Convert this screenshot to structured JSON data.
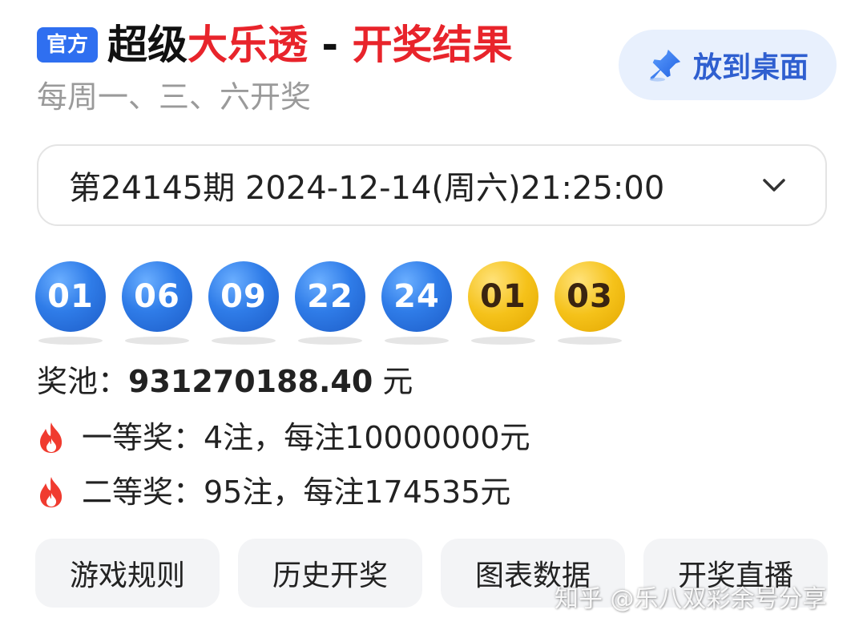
{
  "header": {
    "badge": "官方",
    "title_part1": "超级",
    "title_part2": "大乐透",
    "title_sep": " - ",
    "title_part3": "开奖结果",
    "subtitle": "每周一、三、六开奖",
    "pin_label": "放到桌面"
  },
  "issue": {
    "label": "第24145期 2024-12-14(周六)21:25:00"
  },
  "balls": {
    "front": [
      "01",
      "06",
      "09",
      "22",
      "24"
    ],
    "back": [
      "01",
      "03"
    ]
  },
  "pool": {
    "label": "奖池：",
    "value": "931270188.40",
    "unit": " 元"
  },
  "prizes": [
    {
      "text": "一等奖：4注，每注10000000元"
    },
    {
      "text": "二等奖：95注，每注174535元"
    }
  ],
  "actions": [
    "游戏规则",
    "历史开奖",
    "图表数据",
    "开奖直播"
  ],
  "watermark": "知乎 @乐八双彩余号分享",
  "colors": {
    "red": "#e8242b",
    "blue_badge": "#2f6ff0",
    "blue_ball": "#2f7ce8",
    "yellow_ball": "#f5c21a"
  }
}
